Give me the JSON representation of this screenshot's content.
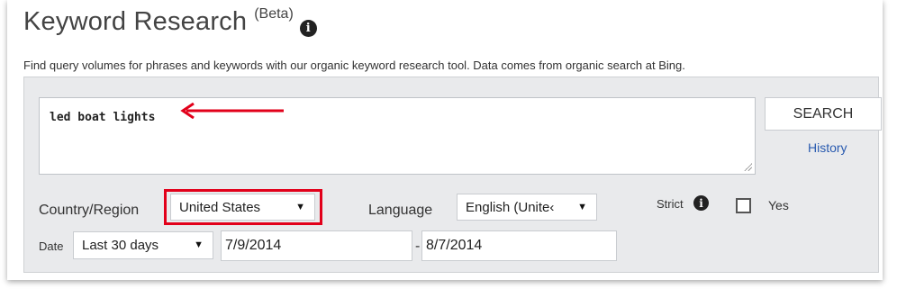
{
  "header": {
    "title": "Keyword Research",
    "beta": "(Beta)",
    "description": "Find query volumes for phrases and keywords with our organic keyword research tool. Data comes from organic search at Bing."
  },
  "query": {
    "value": "led boat lights"
  },
  "actions": {
    "search_label": "SEARCH",
    "history_label": "History"
  },
  "filters": {
    "country_label": "Country/Region",
    "country_value": "United States",
    "language_label": "Language",
    "language_value": "English (Unite‹",
    "strict_label": "Strict",
    "strict_checked": false,
    "yes_label": "Yes",
    "date_label": "Date",
    "date_range_value": "Last 30 days",
    "start_date": "7/9/2014",
    "date_separator": "-",
    "end_date": "8/7/2014"
  },
  "icons": {
    "info": "info-icon",
    "caret": "caret-down-icon",
    "arrow": "red-arrow-annotation"
  },
  "colors": {
    "annotation_red": "#e2001a",
    "link_blue": "#2a5bb0",
    "panel_bg": "#e9eaec"
  }
}
